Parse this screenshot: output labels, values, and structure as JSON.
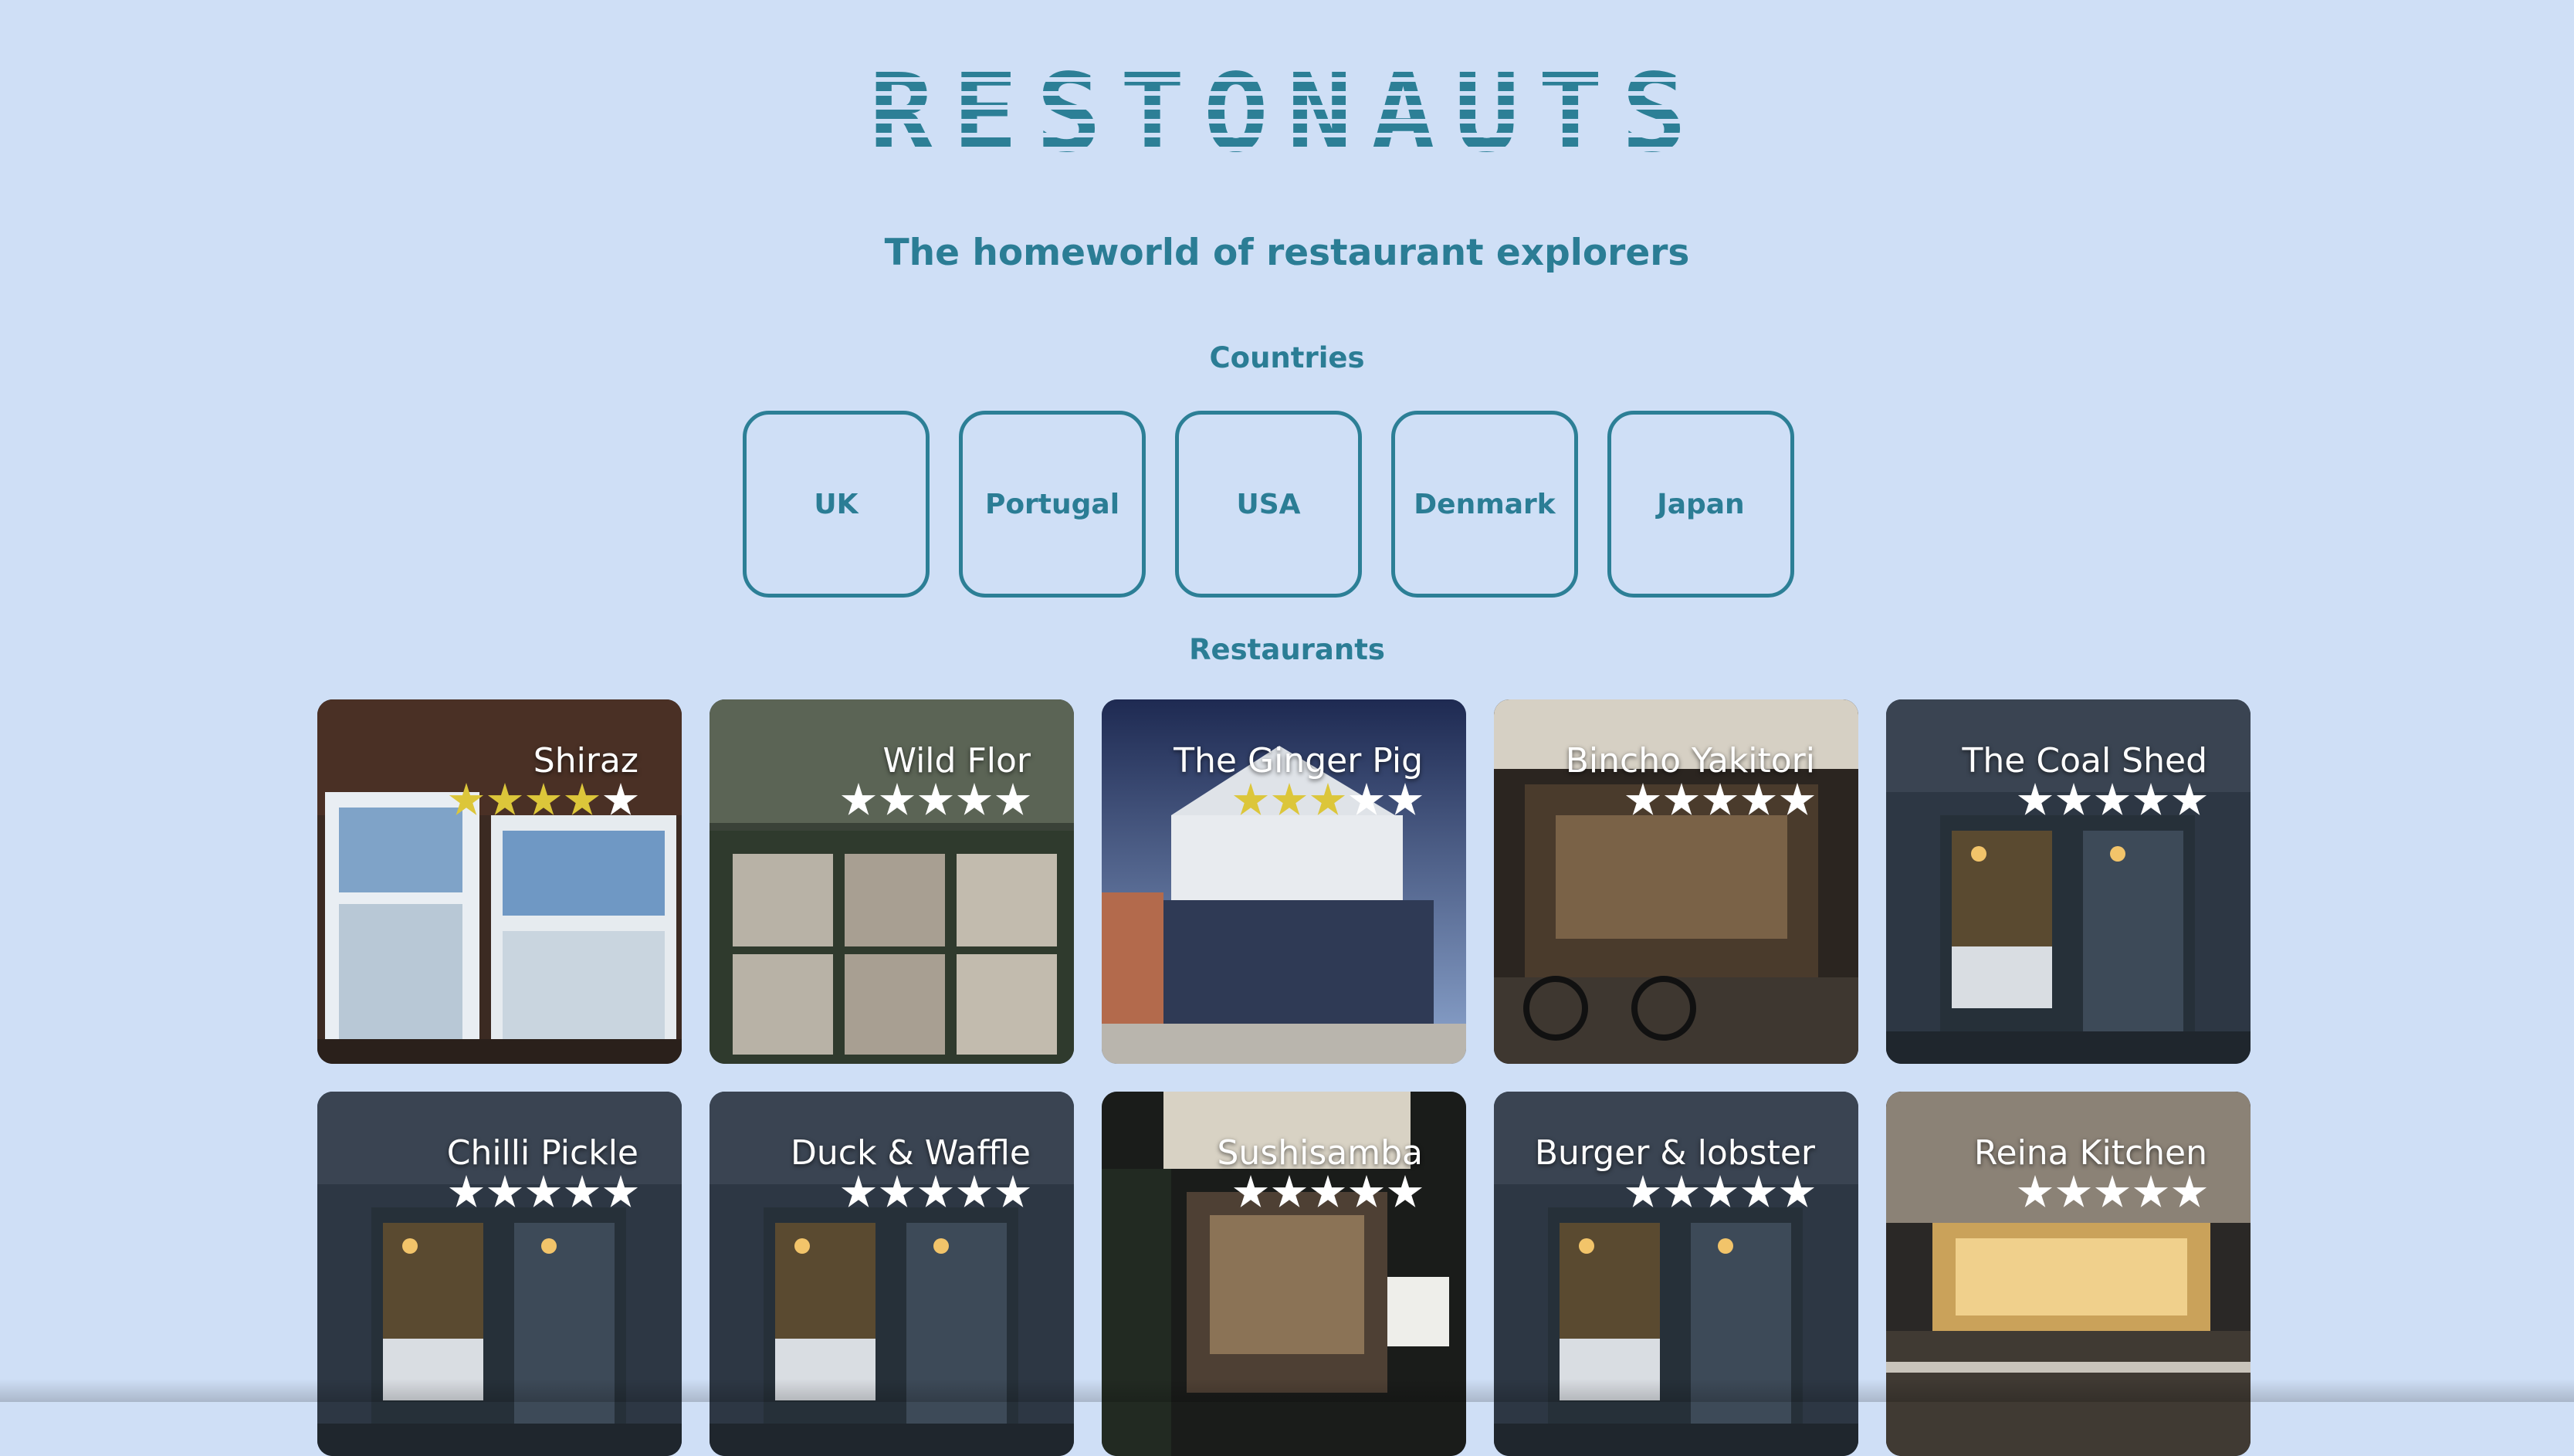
{
  "header": {
    "logo_text": "RESTONAUTS",
    "tagline": "The homeworld of restaurant explorers"
  },
  "countries": {
    "title": "Countries",
    "items": [
      "UK",
      "Portugal",
      "USA",
      "Denmark",
      "Japan"
    ]
  },
  "restaurants": {
    "title": "Restaurants",
    "items": [
      {
        "name": "Shiraz",
        "rating": 4,
        "photo": "storefront-shiraz"
      },
      {
        "name": "Wild Flor",
        "rating": 0,
        "photo": "storefront-wild-flor"
      },
      {
        "name": "The Ginger Pig",
        "rating": 3,
        "photo": "storefront-ginger-pig"
      },
      {
        "name": "Bincho Yakitori",
        "rating": 0,
        "photo": "storefront-yakitori"
      },
      {
        "name": "The Coal Shed",
        "rating": 0,
        "photo": "storefront-coal-shed"
      },
      {
        "name": "Chilli Pickle",
        "rating": 0,
        "photo": "storefront-coal-shed"
      },
      {
        "name": "Duck & Waffle",
        "rating": 0,
        "photo": "storefront-coal-shed"
      },
      {
        "name": "Sushisamba",
        "rating": 0,
        "photo": "storefront-sushi"
      },
      {
        "name": "Burger & lobster",
        "rating": 0,
        "photo": "storefront-coal-shed"
      },
      {
        "name": "Reina Kitchen",
        "rating": 0,
        "photo": "storefront-marceline"
      }
    ],
    "max_rating": 5
  },
  "colors": {
    "background": "#cfdff6",
    "accent": "#2c7f96",
    "star_filled": "#dcc63a",
    "star_empty": "#ffffff"
  }
}
